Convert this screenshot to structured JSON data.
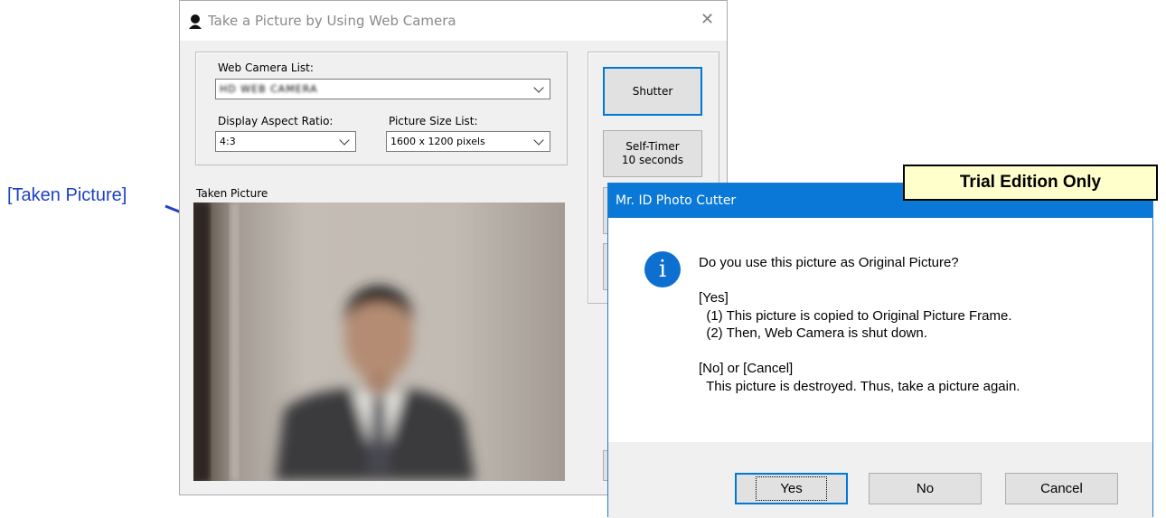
{
  "annotation": {
    "label": "[Taken Picture]",
    "color": "#1e40c8"
  },
  "camera_window": {
    "title": "Take a Picture by Using Web Camera",
    "close_glyph": "✕",
    "web_camera_list": {
      "label": "Web Camera List:",
      "value": "HD WEB CAMERA"
    },
    "display_aspect_ratio": {
      "label": "Display Aspect Ratio:",
      "value": "4:3"
    },
    "picture_size_list": {
      "label": "Picture Size List:",
      "value": "1600 x 1200 pixels"
    },
    "taken_picture_label": "Taken Picture",
    "shutter_button": "Shutter",
    "self_timer_button": {
      "line1": "Self-Timer",
      "line2": "10 seconds"
    }
  },
  "dialog": {
    "title": "Mr. ID Photo Cutter",
    "titlebar_color": "#0a78d7",
    "icon": "info-icon",
    "message": "Do you use this picture as Original Picture?\n\n[Yes]\n  (1) This picture is copied to Original Picture Frame.\n  (2) Then, Web Camera is shut down.\n\n[No] or [Cancel]\n  This picture is destroyed. Thus, take a picture again.",
    "buttons": {
      "yes": "Yes",
      "no": "No",
      "cancel": "Cancel"
    }
  },
  "trial_badge": "Trial Edition Only"
}
